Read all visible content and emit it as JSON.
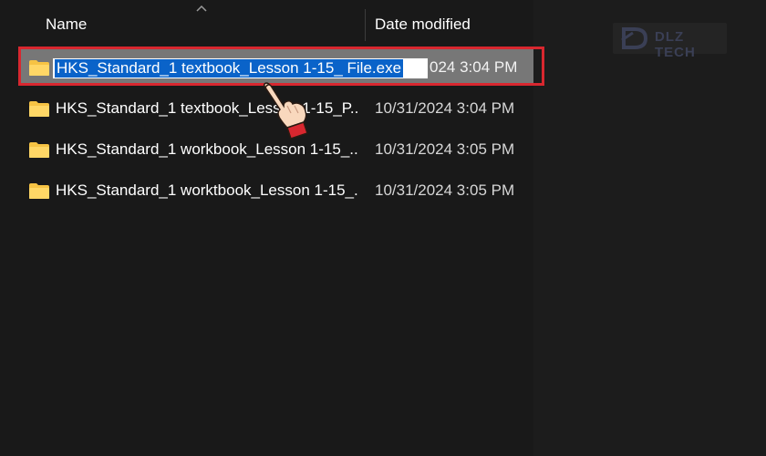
{
  "header": {
    "name_label": "Name",
    "date_label": "Date modified"
  },
  "files": [
    {
      "rename_text": "HKS_Standard_1 textbook_Lesson 1-15_ File.exe",
      "date": "024 3:04 PM",
      "selected": true
    },
    {
      "name": "HKS_Standard_1 textbook_Lesson 1-15_P...",
      "date": "10/31/2024 3:04 PM"
    },
    {
      "name": "HKS_Standard_1 workbook_Lesson 1-15_...",
      "date": "10/31/2024 3:05 PM"
    },
    {
      "name": "HKS_Standard_1 worktbook_Lesson 1-15_...",
      "date": "10/31/2024 3:05 PM"
    }
  ],
  "watermark": {
    "text": "DLZ TECH"
  },
  "colors": {
    "background": "#191919",
    "selected_row": "#777777",
    "rename_selection": "#0a63c9",
    "highlight_border": "#d8272f",
    "folder": "#f6c344"
  },
  "icons": {
    "sort": "chevron-up-icon",
    "folder": "folder-icon",
    "pointer": "hand-pointer-icon"
  }
}
